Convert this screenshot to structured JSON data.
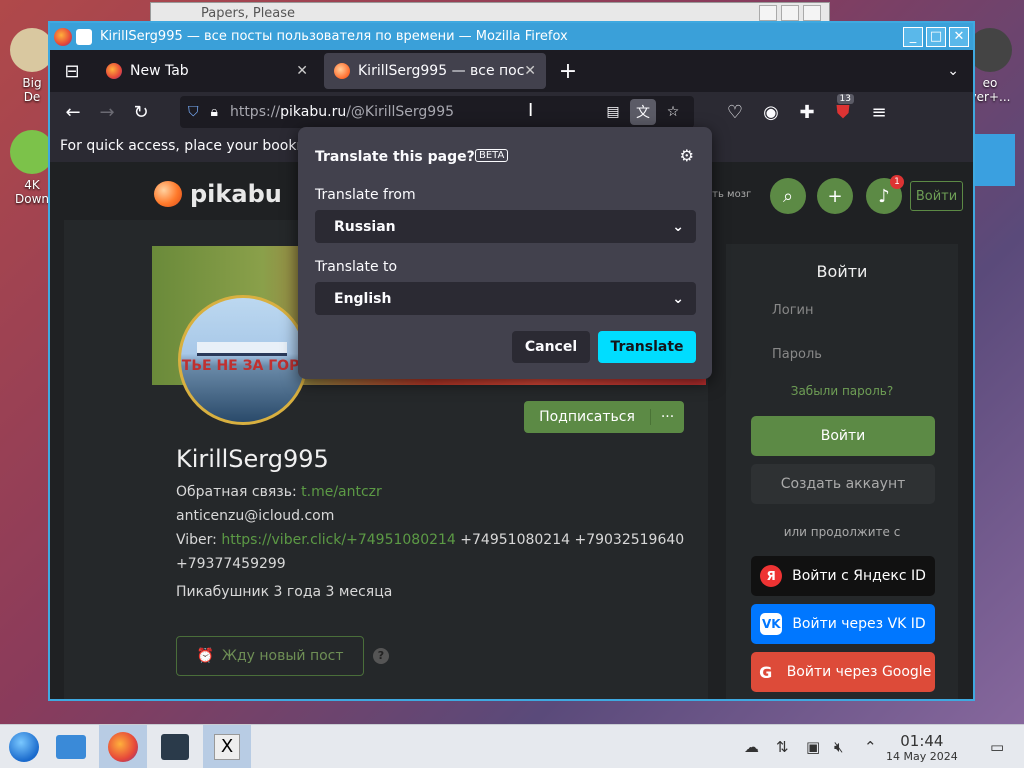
{
  "desktop": {
    "icons": [
      {
        "label": "Big\nDe"
      },
      {
        "label": "4K\nDown"
      },
      {
        "label": "eo\nyer+..."
      }
    ],
    "bg_window_title": "Papers, Please"
  },
  "window": {
    "title": "KirillSerg995 — все посты пользователя по времени — Mozilla Firefox",
    "controls": [
      "_",
      "□",
      "✕"
    ]
  },
  "tabs": [
    {
      "label": "New Tab",
      "active": false
    },
    {
      "label": "KirillSerg995 — все пост",
      "active": true
    }
  ],
  "urlbar": {
    "prefix": "https://",
    "domain": "pikabu.ru",
    "path": "/@KirillSerg995"
  },
  "toolbar": {
    "extension_badge": "13"
  },
  "bookmarks_hint": "For quick access, place your bookm",
  "translate_popup": {
    "title": "Translate this page?",
    "beta": "BETA",
    "from_label": "Translate from",
    "from_value": "Russian",
    "to_label": "Translate to",
    "to_value": "English",
    "cancel": "Cancel",
    "translate": "Translate"
  },
  "site": {
    "logo": "pikabu",
    "header_text": "ать мозг",
    "notif_count": "1",
    "login_top": "Войти",
    "subscribe": "Подписаться",
    "subscribe_more": "···",
    "username": "KirillSerg995",
    "avatar_text": "ТЬЕ НЕ ЗА ГОРА",
    "feedback_label": "Обратная связь:",
    "feedback_link": "t.me/antczr",
    "email": "anticenzu@icloud.com",
    "viber_label": "Viber:",
    "viber_link": "https://viber.click/+74951080214",
    "viber_phones": "+74951080214 +79032519640",
    "phone2": "+79377459299",
    "since": "Пикабушник 3 года 3 месяца",
    "wait_post": "Жду новый пост",
    "help": "?"
  },
  "sidebar": {
    "title": "Войти",
    "login_placeholder": "Логин",
    "password_placeholder": "Пароль",
    "forgot": "Забыли пароль?",
    "login_button": "Войти",
    "create_button": "Создать аккаунт",
    "alt_text": "или продолжите с",
    "yandex": "Войти с Яндекс ID",
    "vk": "Войти через VK ID",
    "google": "Войти через Google"
  },
  "taskbar": {
    "time": "01:44",
    "date": "14 May 2024"
  },
  "colors": {
    "accent": "#00ddff",
    "pikabu_green": "#5c8a45",
    "titlebar": "#3aa0d9",
    "yandex": "#111111",
    "vk": "#0077ff",
    "google": "#dd4b39"
  }
}
